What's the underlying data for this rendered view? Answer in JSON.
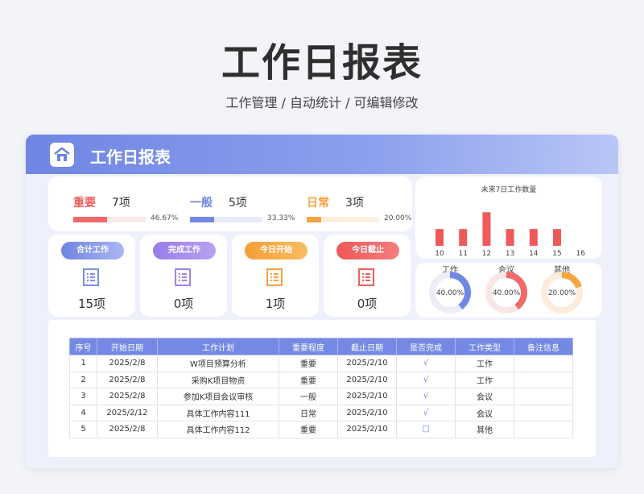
{
  "page": {
    "title": "工作日报表",
    "subtitle": "工作管理 /  自动统计  /  可编辑修改"
  },
  "card": {
    "title": "工作日报表"
  },
  "priority": [
    {
      "label": "重要",
      "count": "7项",
      "pct": "46.67%",
      "value": 0.4667,
      "color": "#ef6b6b",
      "track": "#fbe9ea"
    },
    {
      "label": "一般",
      "count": "5项",
      "pct": "33.33%",
      "value": 0.3333,
      "color": "#7089e0",
      "track": "#e7ebf8"
    },
    {
      "label": "日常",
      "count": "3项",
      "pct": "20.00%",
      "value": 0.2,
      "color": "#f5a443",
      "track": "#fdeede"
    }
  ],
  "stats": [
    {
      "label": "合计工作",
      "value": "15项",
      "color": "#7c8fe6",
      "color2": "#a7b5f2"
    },
    {
      "label": "完成工作",
      "value": "0项",
      "color": "#a083ec",
      "color2": "#b9a2f2"
    },
    {
      "label": "今日开始",
      "value": "1项",
      "color": "#f6a33e",
      "color2": "#f8b860"
    },
    {
      "label": "今日截止",
      "value": "0项",
      "color": "#ef5e5e",
      "color2": "#f57c7c"
    }
  ],
  "chart_data": [
    {
      "type": "bar",
      "title": "未来7日工作数量",
      "categories": [
        "10",
        "11",
        "12",
        "13",
        "14",
        "15",
        "16"
      ],
      "values": [
        1,
        1,
        2,
        1,
        1,
        1,
        0
      ],
      "ylim": [
        0,
        2.4
      ],
      "grid": false,
      "color": "#ee5a5a"
    },
    {
      "type": "pie",
      "donuts": [
        {
          "label": "工作",
          "value": 40.0,
          "text": "40.00%",
          "color": "#6f88e3",
          "track": "#ecedf7"
        },
        {
          "label": "会议",
          "value": 40.0,
          "text": "40.00%",
          "color": "#ef6a6a",
          "track": "#fbe6e6"
        },
        {
          "label": "其他",
          "value": 20.0,
          "text": "20.00%",
          "color": "#f5a53d",
          "track": "#fdecdc"
        }
      ]
    }
  ],
  "table": {
    "headers": [
      "序号",
      "开始日期",
      "工作计划",
      "重要程度",
      "截止日期",
      "是否完成",
      "工作类型",
      "备注信息"
    ],
    "rows": [
      [
        "1",
        "2025/2/8",
        "W项目预算分析",
        "重要",
        "2025/2/10",
        "√",
        "工作",
        ""
      ],
      [
        "2",
        "2025/2/8",
        "采购K项目物资",
        "重要",
        "2025/2/10",
        "√",
        "工作",
        ""
      ],
      [
        "3",
        "2025/2/8",
        "参加K项目会议审核",
        "一般",
        "2025/2/10",
        "√",
        "会议",
        ""
      ],
      [
        "4",
        "2025/2/12",
        "具体工作内容111",
        "日常",
        "2025/2/10",
        "√",
        "会议",
        ""
      ],
      [
        "5",
        "2025/2/8",
        "具体工作内容112",
        "重要",
        "2025/2/10",
        "□",
        "其他",
        ""
      ]
    ]
  }
}
